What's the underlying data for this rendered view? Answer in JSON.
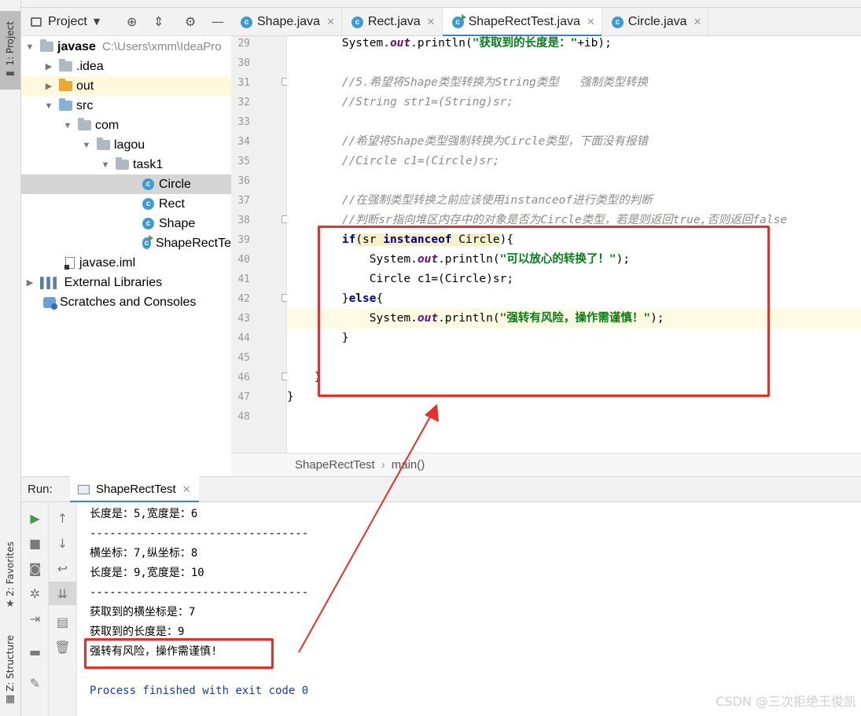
{
  "sidebar_stripe": {
    "project_tab": "1: Project",
    "favorites_tab": "2: Favorites",
    "structure_tab": "Z: Structure"
  },
  "project_panel": {
    "title": "Project",
    "tree": [
      {
        "label": "javase",
        "path": "C:\\Users\\xmm\\IdeaPro",
        "kind": "module"
      },
      {
        "label": ".idea",
        "kind": "folder"
      },
      {
        "label": "out",
        "kind": "folder-orange"
      },
      {
        "label": "src",
        "kind": "folder-blue"
      },
      {
        "label": "com",
        "kind": "package"
      },
      {
        "label": "lagou",
        "kind": "package"
      },
      {
        "label": "task1",
        "kind": "package"
      },
      {
        "label": "Circle",
        "kind": "class"
      },
      {
        "label": "Rect",
        "kind": "class"
      },
      {
        "label": "Shape",
        "kind": "class"
      },
      {
        "label": "ShapeRectTe",
        "kind": "class-run"
      },
      {
        "label": "javase.iml",
        "kind": "file"
      },
      {
        "label": "External Libraries",
        "kind": "libraries"
      },
      {
        "label": "Scratches and Consoles",
        "kind": "scratches"
      }
    ]
  },
  "editor_tabs": [
    {
      "label": "Shape.java",
      "active": false
    },
    {
      "label": "Rect.java",
      "active": false
    },
    {
      "label": "ShapeRectTest.java",
      "active": true
    },
    {
      "label": "Circle.java",
      "active": false
    }
  ],
  "line_numbers": [
    "29",
    "30",
    "31",
    "32",
    "33",
    "34",
    "35",
    "36",
    "37",
    "38",
    "39",
    "40",
    "41",
    "42",
    "43",
    "44",
    "45",
    "46",
    "47",
    "48"
  ],
  "code": {
    "l29_a": "        System.",
    "l29_out": "out",
    "l29_b": ".println(",
    "l29_str": "\"获取到的长度是：\"",
    "l29_c": "+ib);",
    "l31": "        //5.希望将Shape类型转换为String类型   强制类型转换",
    "l32": "        //String str1=(String)sr;",
    "l34": "        //希望将Shape类型强制转换为Circle类型，下面没有报错",
    "l35": "        //Circle c1=(Circle)sr;",
    "l37": "        //在强制类型转换之前应该使用instanceof进行类型的判断",
    "l38": "        //判断sr指向堆区内存中的对象是否为Circle类型，若是则返回true,否则返回false",
    "l39_indent": "        ",
    "l39_if": "if",
    "l39_a": "(sr ",
    "l39_instanceof": "instanceof",
    "l39_b": " Circle",
    "l39_c": "){",
    "l40_a": "            System.",
    "l40_out": "out",
    "l40_b": ".println(",
    "l40_str": "\"可以放心的转换了！\"",
    "l40_c": ");",
    "l41": "            Circle c1=(Circle)sr;",
    "l42_a": "        }",
    "l42_else": "else",
    "l42_b": "{",
    "l43_a": "            System.",
    "l43_out": "out",
    "l43_b": ".println(",
    "l43_str": "\"强转有风险，操作需谨慎！\"",
    "l43_c": ");",
    "l44": "        }",
    "l46": "    }",
    "l47": "}"
  },
  "breadcrumb": {
    "class_name": "ShapeRectTest",
    "method": "main()"
  },
  "run_panel": {
    "label": "Run:",
    "tab": "ShapeRectTest",
    "output": [
      "长度是：5,宽度是：6",
      "---------------------------------",
      "横坐标：7,纵坐标：8",
      "长度是：9,宽度是：10",
      "---------------------------------",
      "获取到的横坐标是：7",
      "获取到的长度是：9",
      "强转有风险，操作需谨慎!",
      "",
      "Process finished with exit code 0"
    ]
  },
  "watermark": "CSDN @三次拒绝王俊凯",
  "colors": {
    "annotation_red": "#e8302a",
    "tab_underline": "#4083c9",
    "keyword": "#000080",
    "string": "#067d17",
    "comment": "#8c8c8c"
  }
}
